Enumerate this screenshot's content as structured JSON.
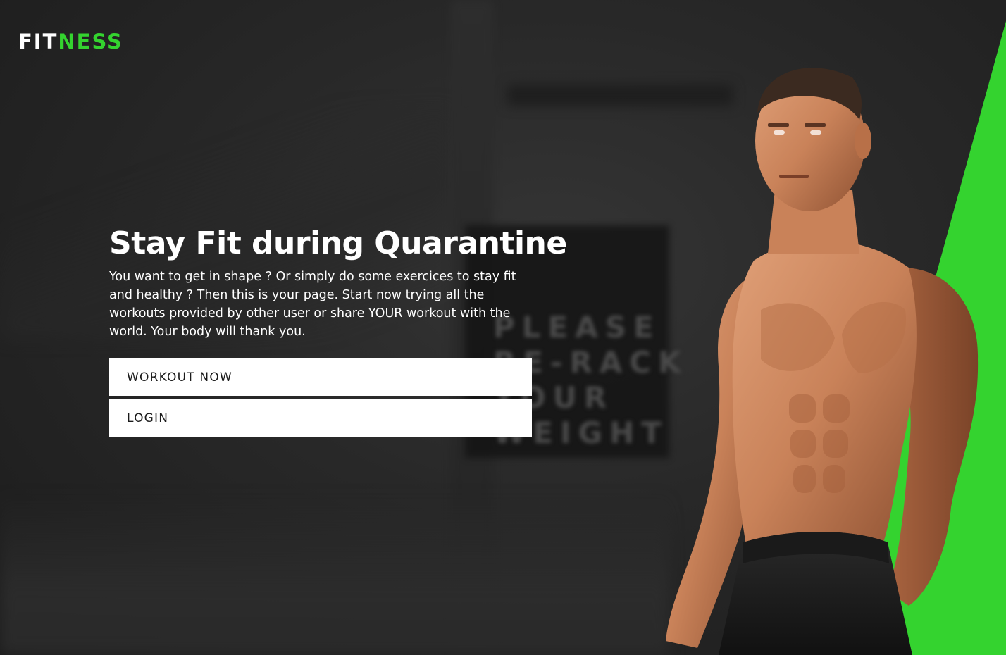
{
  "brand": {
    "logo_part_a": "FIT",
    "logo_part_b": "NESS",
    "accent_color": "#34d32f"
  },
  "hero": {
    "title": "Stay Fit during Quarantine",
    "description": "You want to get in shape ? Or simply do some exercices to stay fit and healthy ? Then this is your page. Start now trying all the workouts provided by other user or share YOUR workout with the world. Your body will thank you.",
    "workout_button_label": "WORKOUT NOW",
    "login_button_label": "LOGIN"
  },
  "background": {
    "sign_text": "PLEASE\nRE-RACK\nYOUR\nWEIGHT"
  }
}
